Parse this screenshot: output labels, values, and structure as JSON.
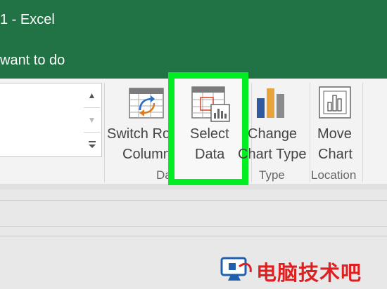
{
  "title_bar": {
    "title": "1  -  Excel"
  },
  "tell_me": {
    "text": "want to do"
  },
  "ribbon": {
    "buttons": {
      "switch_row_column": {
        "line1": "Switch Row/",
        "line2": "Column"
      },
      "select_data": {
        "line1": "Select",
        "line2": "Data"
      },
      "change_chart_type": {
        "line1": "Change",
        "line2": "Chart Type"
      },
      "move_chart": {
        "line1": "Move",
        "line2": "Chart"
      }
    },
    "groups": {
      "data": "Data",
      "type": "Type",
      "location": "Location"
    }
  },
  "colors": {
    "excel_green": "#217346",
    "highlight": "#00ee22",
    "watermark": "#e02020"
  },
  "watermark": {
    "text": "电脑技术吧",
    "icon": "monitor-logo-icon"
  }
}
